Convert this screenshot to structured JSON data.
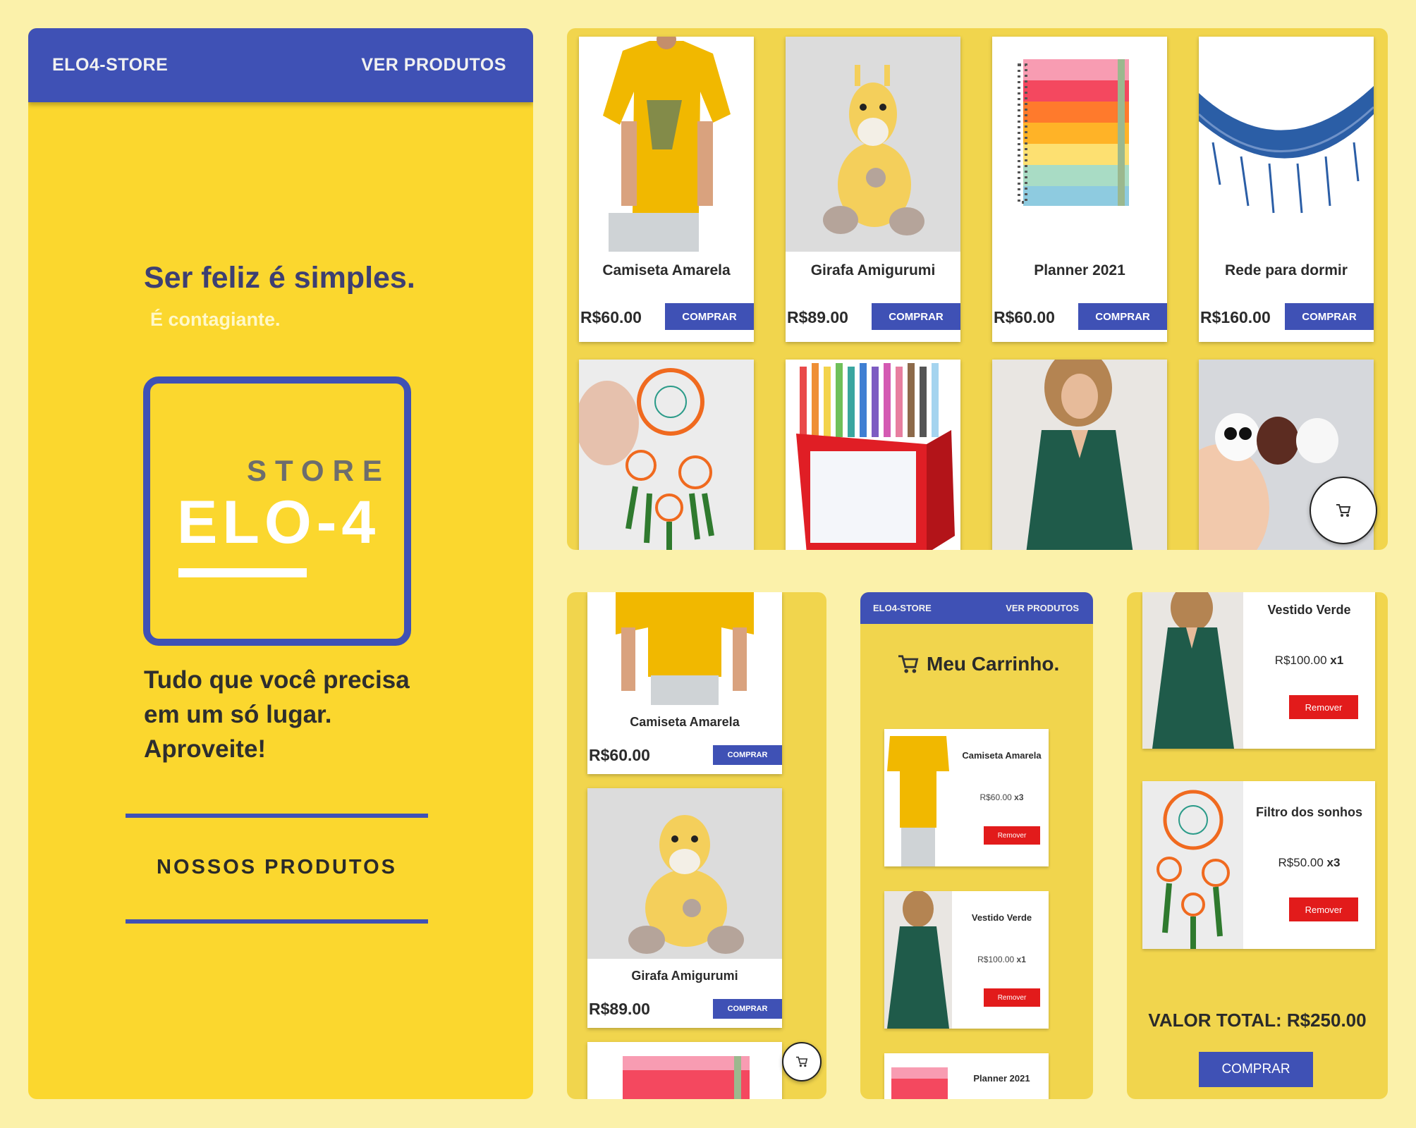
{
  "landing": {
    "brand": "ELO4-STORE",
    "nav_products": "VER PRODUTOS",
    "tagline": "Ser feliz é simples.",
    "subtagline": "É contagiante.",
    "logo_store": "STORE",
    "logo_name": "ELO-4",
    "description": "Tudo que você precisa em um só lugar. Aproveite!",
    "cta": "NOSSOS PRODUTOS"
  },
  "products": [
    {
      "name": "Camiseta Amarela",
      "price": "R$60.00",
      "buy": "COMPRAR",
      "icon": "yellow-tshirt-image"
    },
    {
      "name": "Girafa Amigurumi",
      "price": "R$89.00",
      "buy": "COMPRAR",
      "icon": "giraffe-toy-image"
    },
    {
      "name": "Planner 2021",
      "price": "R$60.00",
      "buy": "COMPRAR",
      "icon": "planner-image"
    },
    {
      "name": "Rede para dormir",
      "price": "R$160.00",
      "buy": "COMPRAR",
      "icon": "hammock-image"
    }
  ],
  "products_row2": [
    "dreamcatcher-image",
    "markers-box-image",
    "green-dress-image",
    "bear-toys-image"
  ],
  "mobile": {
    "brand": "ELO4-STORE",
    "nav_products": "VER PRODUTOS",
    "cart_title": "Meu Carrinho.",
    "cart_items": [
      {
        "name": "Camiseta Amarela",
        "price": "R$60.00",
        "qty": "x3",
        "remove": "Remover"
      },
      {
        "name": "Vestido Verde",
        "price": "R$100.00",
        "qty": "x1",
        "remove": "Remover"
      },
      {
        "name": "Planner 2021"
      }
    ]
  },
  "cart": {
    "items": [
      {
        "name": "Vestido Verde",
        "price": "R$100.00",
        "qty": "x1",
        "remove": "Remover"
      },
      {
        "name": "Filtro dos sonhos",
        "price": "R$50.00",
        "qty": "x3",
        "remove": "Remover"
      }
    ],
    "total": "VALOR TOTAL: R$250.00",
    "buy": "COMPRAR"
  },
  "colors": {
    "primary": "#3f51b5",
    "yellow": "#fbd72e",
    "panel_bg": "#f1d54d",
    "remove": "#e21b1b"
  }
}
